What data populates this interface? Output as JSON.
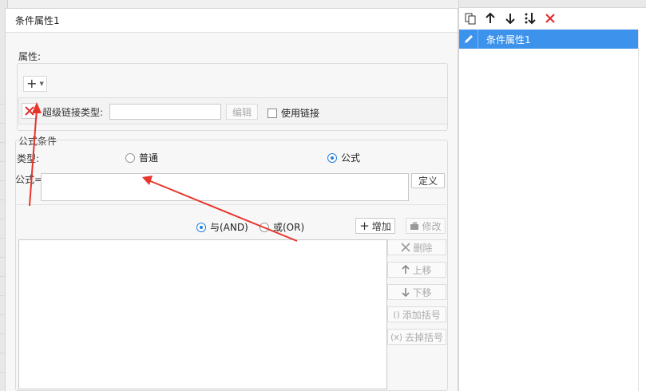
{
  "dialog": {
    "title": "条件属性1"
  },
  "properties": {
    "group_label": "属性:",
    "hyperlink_type_label": "超级链接类型:",
    "hyperlink_type_value": "",
    "edit_label": "编辑",
    "use_link_label": "使用链接"
  },
  "formula_condition": {
    "group_label": "公式条件",
    "type_label": "类型:",
    "type_normal": "普通",
    "type_formula": "公式",
    "selected_type": "公式",
    "formula_label": "公式=",
    "formula_value": "",
    "define_label": "定义",
    "and_label": "与(AND)",
    "or_label": "或(OR)",
    "selected_logic": "与(AND)",
    "add_label": "增加",
    "modify_label": "修改",
    "delete_label": "删除",
    "move_up_label": "上移",
    "move_down_label": "下移",
    "add_bracket_label": "添加括号",
    "remove_bracket_label": "去掉括号"
  },
  "side_panel": {
    "items": [
      {
        "label": "条件属性1",
        "selected": true
      }
    ]
  },
  "colors": {
    "accent": "#3d93ec",
    "delete_red": "#e03030",
    "annotation_red": "#e8352b"
  }
}
